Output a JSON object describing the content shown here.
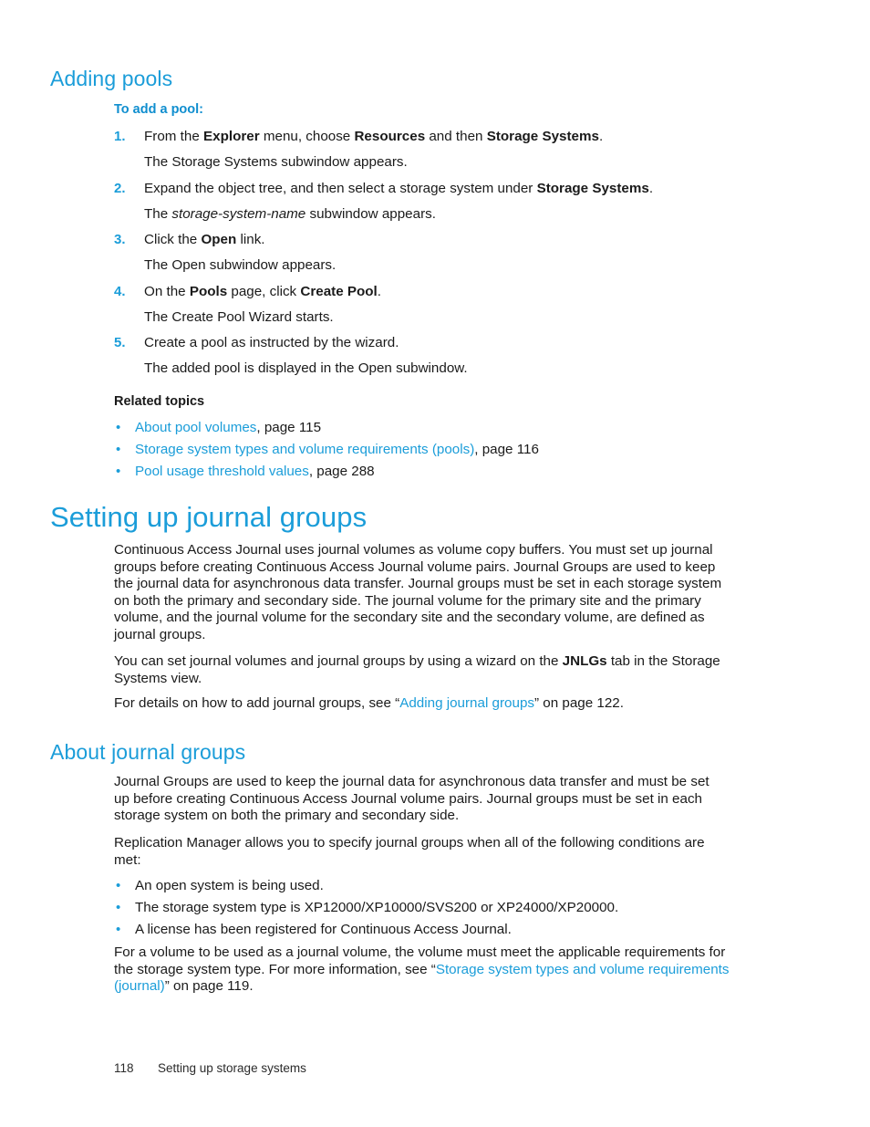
{
  "sections": {
    "adding_pools": {
      "heading": "Adding pools",
      "subheading": "To add a pool:",
      "steps": [
        {
          "number": "1.",
          "text_parts": [
            {
              "t": "From the ",
              "style": "normal"
            },
            {
              "t": "Explorer",
              "style": "bold"
            },
            {
              "t": " menu, choose ",
              "style": "normal"
            },
            {
              "t": "Resources",
              "style": "bold"
            },
            {
              "t": " and then ",
              "style": "normal"
            },
            {
              "t": "Storage Systems",
              "style": "bold"
            },
            {
              "t": ".",
              "style": "normal"
            }
          ],
          "result": "The Storage Systems subwindow appears."
        },
        {
          "number": "2.",
          "text_parts": [
            {
              "t": "Expand the object tree, and then select a storage system under ",
              "style": "normal"
            },
            {
              "t": "Storage Systems",
              "style": "bold"
            },
            {
              "t": ".",
              "style": "normal"
            }
          ],
          "result_parts": [
            {
              "t": "The ",
              "style": "normal"
            },
            {
              "t": "storage-system-name",
              "style": "italic"
            },
            {
              "t": " subwindow appears.",
              "style": "normal"
            }
          ]
        },
        {
          "number": "3.",
          "text_parts": [
            {
              "t": "Click the ",
              "style": "normal"
            },
            {
              "t": "Open",
              "style": "bold"
            },
            {
              "t": " link.",
              "style": "normal"
            }
          ],
          "result": "The Open subwindow appears."
        },
        {
          "number": "4.",
          "text_parts": [
            {
              "t": "On the ",
              "style": "normal"
            },
            {
              "t": "Pools",
              "style": "bold"
            },
            {
              "t": " page, click ",
              "style": "normal"
            },
            {
              "t": "Create Pool",
              "style": "bold"
            },
            {
              "t": ".",
              "style": "normal"
            }
          ],
          "result": "The Create Pool Wizard starts."
        },
        {
          "number": "5.",
          "text_parts": [
            {
              "t": "Create a pool as instructed by the wizard.",
              "style": "normal"
            }
          ],
          "result": "The added pool is displayed in the Open subwindow."
        }
      ],
      "related_topics_heading": "Related topics",
      "related_topics": [
        {
          "bullet": "•",
          "link": "About pool volumes",
          "tail": ", page 115"
        },
        {
          "bullet": "•",
          "link": "Storage system types and volume requirements (pools)",
          "tail": ", page 116"
        },
        {
          "bullet": "•",
          "link": "Pool usage threshold values",
          "tail": ", page 288"
        }
      ]
    },
    "setting_up_journal_groups": {
      "heading": "Setting up journal groups",
      "paragraph1": "Continuous Access Journal uses journal volumes as volume copy buffers. You must set up journal groups before creating Continuous Access Journal volume pairs. Journal Groups are used to keep the journal data for asynchronous data transfer. Journal groups must be set in each storage system on both the primary and secondary side. The journal volume for the primary site and the primary volume, and the journal volume for the secondary site and the secondary volume, are defined as journal groups.",
      "paragraph2_parts": [
        {
          "t": "You can set journal volumes and journal groups by using a wizard on the ",
          "style": "normal"
        },
        {
          "t": "JNLGs",
          "style": "bold"
        },
        {
          "t": " tab in the Storage Systems view.",
          "style": "normal"
        }
      ],
      "paragraph3_parts": [
        {
          "t": " For details on how to add journal groups, see “",
          "style": "normal"
        },
        {
          "t": "Adding journal groups",
          "style": "link"
        },
        {
          "t": "” on page 122.",
          "style": "normal"
        }
      ]
    },
    "about_journal_groups": {
      "heading": "About journal groups",
      "paragraph1": "Journal Groups are used to keep the journal data for asynchronous data transfer and must be set up before creating Continuous Access Journal volume pairs. Journal groups must be set in each storage system on both the primary and secondary side.",
      "paragraph2": "Replication Manager allows you to specify journal groups when all of the following conditions are met:",
      "conditions": [
        {
          "bullet": "•",
          "text": "An open system is being used."
        },
        {
          "bullet": "•",
          "text": "The storage system type is XP12000/XP10000/SVS200 or XP24000/XP20000."
        },
        {
          "bullet": "•",
          "text": "A license has been registered for Continuous Access Journal."
        }
      ],
      "paragraph3_parts": [
        {
          "t": "For a volume to be used as a journal volume, the volume must meet the applicable requirements for the storage system type. For more information, see “",
          "style": "normal"
        },
        {
          "t": "Storage system types and volume requirements (journal)",
          "style": "link"
        },
        {
          "t": "” on page 119.",
          "style": "normal"
        }
      ]
    }
  },
  "footer": {
    "page_number": "118",
    "section_title": "Setting up storage systems"
  },
  "colors": {
    "heading_blue": "#1b9dd9",
    "link_blue": "#1b9dd9",
    "body_black": "#1a1a1a"
  }
}
